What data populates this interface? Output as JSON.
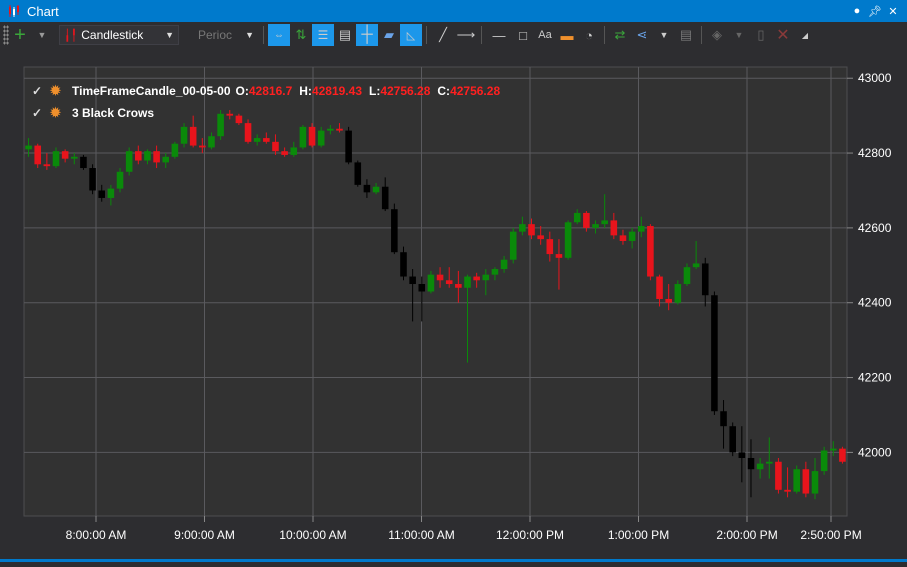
{
  "window": {
    "title": "Chart",
    "pin_icon": "pin-icon",
    "close_icon": "close-icon"
  },
  "toolbar": {
    "chart_type": "Candlestick",
    "period_placeholder": "Perioc"
  },
  "legend": [
    {
      "name": "TimeFrameCandle_00-05-00",
      "o_label": "O:",
      "o": "42816.7",
      "h_label": "H:",
      "h": "42819.43",
      "l_label": "L:",
      "l": "42756.28",
      "c_label": "C:",
      "c": "42756.28"
    },
    {
      "name": "3 Black Crows"
    }
  ],
  "colors": {
    "up": "#0a8a0a",
    "down": "#e8141c",
    "pattern": "#000000",
    "grid": "#5a5a5e",
    "bg": "#323232"
  },
  "chart_data": {
    "type": "candlestick",
    "ylim": [
      41830,
      43030
    ],
    "yticks": [
      42000,
      42200,
      42400,
      42600,
      42800,
      43000
    ],
    "xticks": [
      "8:00:00 AM",
      "9:00:00 AM",
      "10:00:00 AM",
      "11:00:00 AM",
      "12:00:00 PM",
      "1:00:00 PM",
      "2:00:00 PM",
      "2:50:00 PM"
    ],
    "candles": [
      [
        42810,
        42840,
        42790,
        42820
      ],
      [
        42820,
        42825,
        42760,
        42770
      ],
      [
        42770,
        42800,
        42755,
        42765
      ],
      [
        42765,
        42815,
        42760,
        42805
      ],
      [
        42805,
        42810,
        42775,
        42785
      ],
      [
        42785,
        42800,
        42770,
        42790
      ],
      [
        42790,
        42795,
        42755,
        42760
      ],
      [
        42760,
        42770,
        42690,
        42700
      ],
      [
        42700,
        42715,
        42670,
        42680
      ],
      [
        42680,
        42715,
        42660,
        42705
      ],
      [
        42705,
        42760,
        42695,
        42750
      ],
      [
        42750,
        42815,
        42740,
        42805
      ],
      [
        42805,
        42820,
        42770,
        42780
      ],
      [
        42780,
        42810,
        42770,
        42805
      ],
      [
        42805,
        42820,
        42760,
        42775
      ],
      [
        42775,
        42800,
        42760,
        42790
      ],
      [
        42790,
        42830,
        42785,
        42825
      ],
      [
        42825,
        42880,
        42815,
        42870
      ],
      [
        42870,
        42900,
        42815,
        42820
      ],
      [
        42820,
        42840,
        42800,
        42815
      ],
      [
        42815,
        42855,
        42810,
        42845
      ],
      [
        42845,
        42915,
        42835,
        42905
      ],
      [
        42905,
        42915,
        42890,
        42900
      ],
      [
        42900,
        42905,
        42875,
        42880
      ],
      [
        42880,
        42890,
        42825,
        42830
      ],
      [
        42830,
        42850,
        42820,
        42840
      ],
      [
        42840,
        42855,
        42825,
        42830
      ],
      [
        42830,
        42850,
        42795,
        42805
      ],
      [
        42805,
        42815,
        42790,
        42795
      ],
      [
        42795,
        42830,
        42790,
        42815
      ],
      [
        42815,
        42875,
        42810,
        42870
      ],
      [
        42870,
        42880,
        42815,
        42820
      ],
      [
        42820,
        42870,
        42815,
        42860
      ],
      [
        42860,
        42875,
        42850,
        42865
      ],
      [
        42865,
        42880,
        42855,
        42860
      ],
      [
        42860,
        42870,
        42770,
        42775
      ],
      [
        42775,
        42780,
        42710,
        42715
      ],
      [
        42715,
        42730,
        42680,
        42695
      ],
      [
        42695,
        42720,
        42690,
        42710
      ],
      [
        42710,
        42735,
        42645,
        42650
      ],
      [
        42650,
        42665,
        42530,
        42535
      ],
      [
        42535,
        42550,
        42460,
        42470
      ],
      [
        42470,
        42490,
        42350,
        42450
      ],
      [
        42450,
        42470,
        42350,
        42430
      ],
      [
        42430,
        42485,
        42425,
        42475
      ],
      [
        42475,
        42495,
        42440,
        42460
      ],
      [
        42460,
        42495,
        42440,
        42450
      ],
      [
        42450,
        42485,
        42400,
        42440
      ],
      [
        42440,
        42475,
        42240,
        42470
      ],
      [
        42470,
        42480,
        42440,
        42460
      ],
      [
        42460,
        42490,
        42420,
        42475
      ],
      [
        42475,
        42495,
        42460,
        42490
      ],
      [
        42490,
        42525,
        42480,
        42515
      ],
      [
        42515,
        42600,
        42505,
        42590
      ],
      [
        42590,
        42630,
        42580,
        42610
      ],
      [
        42610,
        42625,
        42570,
        42580
      ],
      [
        42580,
        42605,
        42555,
        42570
      ],
      [
        42570,
        42590,
        42510,
        42530
      ],
      [
        42530,
        42570,
        42435,
        42520
      ],
      [
        42520,
        42620,
        42515,
        42615
      ],
      [
        42615,
        42650,
        42610,
        42640
      ],
      [
        42640,
        42645,
        42590,
        42600
      ],
      [
        42600,
        42620,
        42585,
        42610
      ],
      [
        42610,
        42690,
        42600,
        42620
      ],
      [
        42620,
        42640,
        42570,
        42580
      ],
      [
        42580,
        42595,
        42555,
        42565
      ],
      [
        42565,
        42600,
        42545,
        42590
      ],
      [
        42590,
        42630,
        42575,
        42605
      ],
      [
        42605,
        42610,
        42460,
        42470
      ],
      [
        42470,
        42475,
        42390,
        42410
      ],
      [
        42410,
        42450,
        42380,
        42400
      ],
      [
        42400,
        42460,
        42395,
        42450
      ],
      [
        42450,
        42505,
        42445,
        42495
      ],
      [
        42495,
        42565,
        42490,
        42505
      ],
      [
        42505,
        42520,
        42390,
        42420
      ],
      [
        42420,
        42430,
        42100,
        42110
      ],
      [
        42110,
        42140,
        42010,
        42070
      ],
      [
        42070,
        42080,
        41990,
        42000
      ],
      [
        42000,
        42070,
        41920,
        41985
      ],
      [
        41985,
        42035,
        41880,
        41955
      ],
      [
        41955,
        41985,
        41930,
        41970
      ],
      [
        41970,
        42040,
        41930,
        41975
      ],
      [
        41975,
        41985,
        41890,
        41900
      ],
      [
        41900,
        41960,
        41880,
        41895
      ],
      [
        41895,
        41965,
        41890,
        41955
      ],
      [
        41955,
        41975,
        41880,
        41890
      ],
      [
        41890,
        41985,
        41875,
        41950
      ],
      [
        41950,
        42015,
        41940,
        42005
      ],
      [
        42005,
        42030,
        41990,
        42010
      ],
      [
        42010,
        42015,
        41970,
        41975
      ]
    ]
  }
}
